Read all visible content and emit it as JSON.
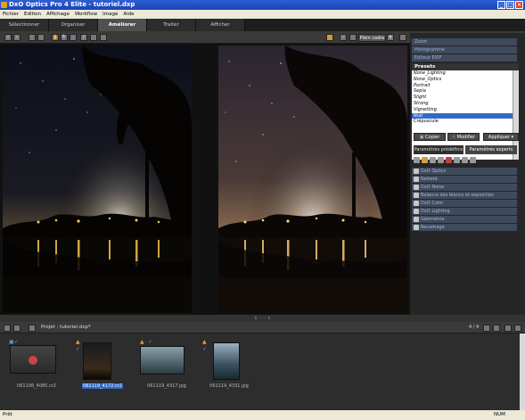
{
  "window": {
    "title": "DxO Optics Pro 4 Elite - tutoriel.dxp"
  },
  "menu": [
    "Fichier",
    "Edition",
    "Affichage",
    "Workflow",
    "Image",
    "Aide"
  ],
  "tabs": [
    "Sélectionner",
    "Organiser",
    "Améliorer",
    "Traiter",
    "Afficher"
  ],
  "toolbar": {
    "fit_label": "Plein cadre"
  },
  "right_panel": {
    "collapsed": [
      "Zoom",
      "Histogramme",
      "Editeur EXIF"
    ],
    "presets_title": "Presets",
    "presets": [
      "None_Lighting",
      "None_Optics",
      "Portrait",
      "Sepia",
      "Slight",
      "Strong",
      "Vignetting",
      "Nuit",
      "Crépuscule"
    ],
    "selected_preset": "Nuit",
    "copy_label": "Copier",
    "modify_label": "Modifier",
    "apply_label": "Appliquer",
    "subtabs": [
      "Paramètres prédéfinis",
      "Paramètres experts"
    ],
    "sections": [
      "DxO Optics",
      "Netteté",
      "DxO Noise",
      "Balance des blancs et exposition",
      "DxO Color",
      "DxO Lighting",
      "Géométrie",
      "Recadrage"
    ]
  },
  "project": {
    "label": "Projet :",
    "name": "tutoriel.dxp*",
    "count": "4 / 4"
  },
  "thumbnails": [
    {
      "name": "061106_4085.cr2",
      "selected": false
    },
    {
      "name": "061119_4172.cr2",
      "selected": true
    },
    {
      "name": "061119_4317.jpg",
      "selected": false
    },
    {
      "name": "061119_4331.jpg",
      "selected": false
    }
  ],
  "status": {
    "left": "Prêt",
    "right": "NUM"
  },
  "colors": {
    "accent": "#316ac5",
    "title_bar": "#2454c8",
    "section": "#3f4a5c"
  }
}
